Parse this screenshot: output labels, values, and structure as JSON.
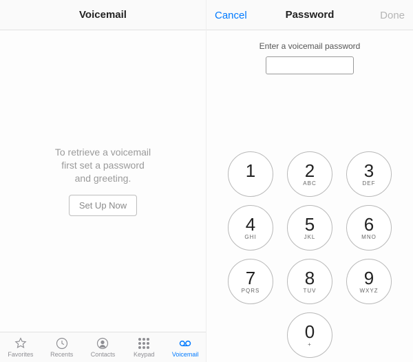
{
  "left": {
    "title": "Voicemail",
    "prompt": "To retrieve a voicemail\nfirst set a password\nand greeting.",
    "setup_button": "Set Up Now"
  },
  "tabs": {
    "favorites": "Favorites",
    "recents": "Recents",
    "contacts": "Contacts",
    "keypad": "Keypad",
    "voicemail": "Voicemail"
  },
  "right": {
    "cancel": "Cancel",
    "title": "Password",
    "done": "Done",
    "enter_prompt": "Enter a voicemail password"
  },
  "keypad": {
    "k1": {
      "d": "1",
      "l": ""
    },
    "k2": {
      "d": "2",
      "l": "ABC"
    },
    "k3": {
      "d": "3",
      "l": "DEF"
    },
    "k4": {
      "d": "4",
      "l": "GHI"
    },
    "k5": {
      "d": "5",
      "l": "JKL"
    },
    "k6": {
      "d": "6",
      "l": "MNO"
    },
    "k7": {
      "d": "7",
      "l": "PQRS"
    },
    "k8": {
      "d": "8",
      "l": "TUV"
    },
    "k9": {
      "d": "9",
      "l": "WXYZ"
    },
    "k0": {
      "d": "0",
      "l": "+"
    }
  }
}
